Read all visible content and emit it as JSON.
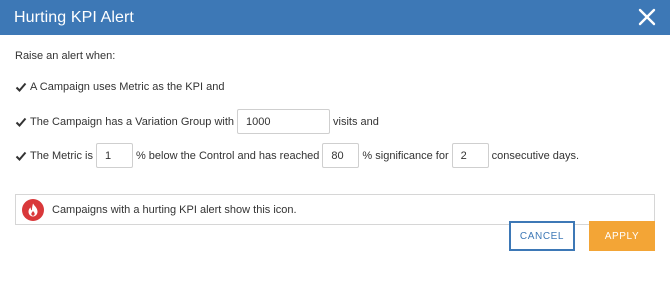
{
  "dialog": {
    "title": "Hurting KPI Alert"
  },
  "content": {
    "intro": "Raise an alert when:",
    "condition1": {
      "text": "A Campaign uses Metric as the KPI and"
    },
    "condition2": {
      "before": "The Campaign has a Variation Group with",
      "visits_value": "1000",
      "after": "visits and"
    },
    "condition3": {
      "before": "The Metric is",
      "percent_value": "1",
      "middle": "% below the Control and has reached",
      "significance_value": "80",
      "after_significance": "% significance for",
      "days_value": "2",
      "after": "consecutive days."
    },
    "info": {
      "text": "Campaigns with a hurting KPI alert show this icon."
    }
  },
  "buttons": {
    "cancel_label": "CANCEL",
    "apply_label": "APPLY"
  },
  "colors": {
    "header": "#3d78b6",
    "apply": "#f3a536",
    "flame_badge": "#d9383a"
  },
  "icons": [
    "close-icon",
    "checkmark-icon",
    "flame-icon"
  ]
}
